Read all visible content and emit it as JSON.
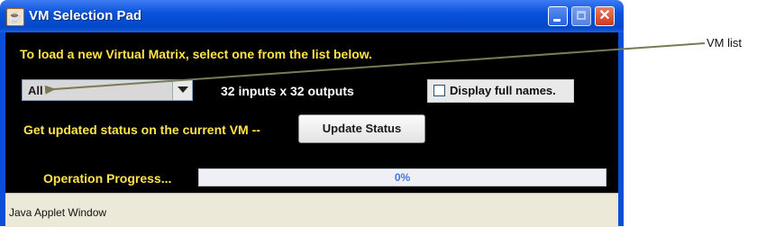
{
  "window": {
    "title": "VM Selection Pad",
    "close_glyph": "✕"
  },
  "main": {
    "instruction": "To load a new Virtual Matrix, select one from the list below.",
    "vm_select": {
      "selected_value": "All"
    },
    "io_summary": "32 inputs x 32 outputs",
    "display_full_names": {
      "label": "Display full names.",
      "checked": false
    },
    "status_prompt": "Get updated status on the current VM --",
    "update_button": "Update Status",
    "progress": {
      "label": "Operation Progress...",
      "value": 0,
      "text": "0%"
    }
  },
  "status_bar": {
    "text": "Java Applet Window"
  },
  "annotation": {
    "label": "VM list"
  },
  "icons": [
    "java-applet-icon",
    "minimize-icon",
    "maximize-icon",
    "close-icon",
    "chevron-down-icon"
  ],
  "colors": {
    "accent_text": "#ffe34a",
    "titlebar": "#0a52dd",
    "content_bg": "#000000",
    "callout_arrow": "#7a7a55"
  }
}
